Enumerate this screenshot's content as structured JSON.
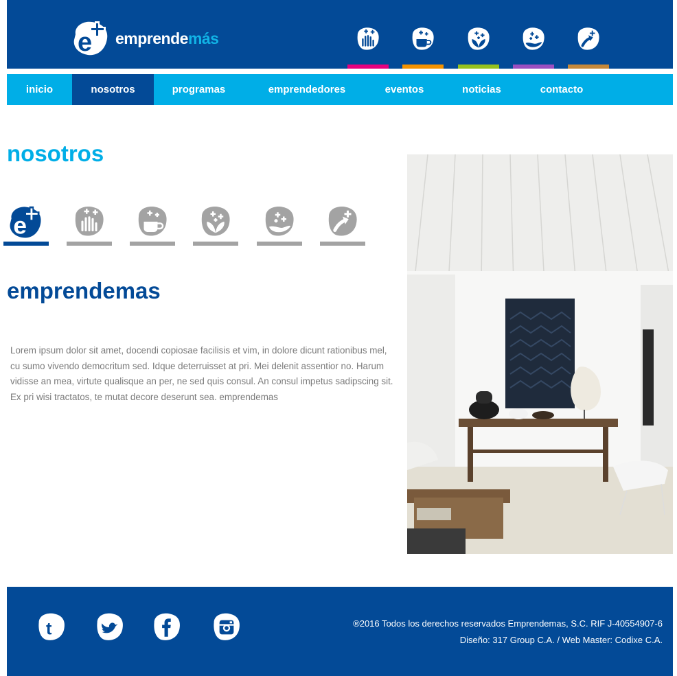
{
  "brand": {
    "logo_text_main": "emprende",
    "logo_text_accent": "más",
    "primary_color": "#034a97",
    "accent_color": "#00aee7"
  },
  "header": {
    "program_icons": [
      {
        "icon": "hand-plus-icon",
        "color": "#e6007e"
      },
      {
        "icon": "cup-plus-icon",
        "color": "#f39200"
      },
      {
        "icon": "leaf-plus-icon",
        "color": "#95c11f"
      },
      {
        "icon": "hand-hold-plus-icon",
        "color": "#9b4fc0"
      },
      {
        "icon": "arrow-plus-icon",
        "color": "#c4883a"
      }
    ]
  },
  "nav": {
    "items": [
      {
        "label": "inicio"
      },
      {
        "label": "nosotros",
        "active": true
      },
      {
        "label": "programas"
      },
      {
        "label": "emprendedores"
      },
      {
        "label": "eventos"
      },
      {
        "label": "noticias"
      },
      {
        "label": "contacto"
      }
    ]
  },
  "main": {
    "page_title": "nosotros",
    "tabs": [
      {
        "icon": "emprendemas-logo-icon",
        "active": true
      },
      {
        "icon": "hand-plus-icon"
      },
      {
        "icon": "cup-plus-icon"
      },
      {
        "icon": "leaf-plus-icon"
      },
      {
        "icon": "hand-hold-plus-icon"
      },
      {
        "icon": "arrow-plus-icon"
      }
    ],
    "section_title": "emprendemas",
    "body": "Lorem ipsum dolor sit amet, docendi copiosae facilisis et vim, in dolore dicunt rationibus mel, cu sumo vivendo democritum sed. Idque deterruisset at pri. Mei delenit assentior no. Harum vidisse an mea, virtute qualisque an per, ne sed quis consul. An consul impetus sadipscing sit. Ex pri wisi tractatos, te mutat decore deserunt sea. emprendemas"
  },
  "footer": {
    "social": [
      {
        "icon": "tumblr-icon"
      },
      {
        "icon": "twitter-icon"
      },
      {
        "icon": "facebook-icon"
      },
      {
        "icon": "instagram-icon"
      }
    ],
    "copyright_line1": "®2016 Todos los derechos reservados Emprendemas, S.C. RIF J-40554907-6",
    "copyright_line2": "Diseño: 317 Group C.A. / Web Master: Codixe C.A."
  }
}
